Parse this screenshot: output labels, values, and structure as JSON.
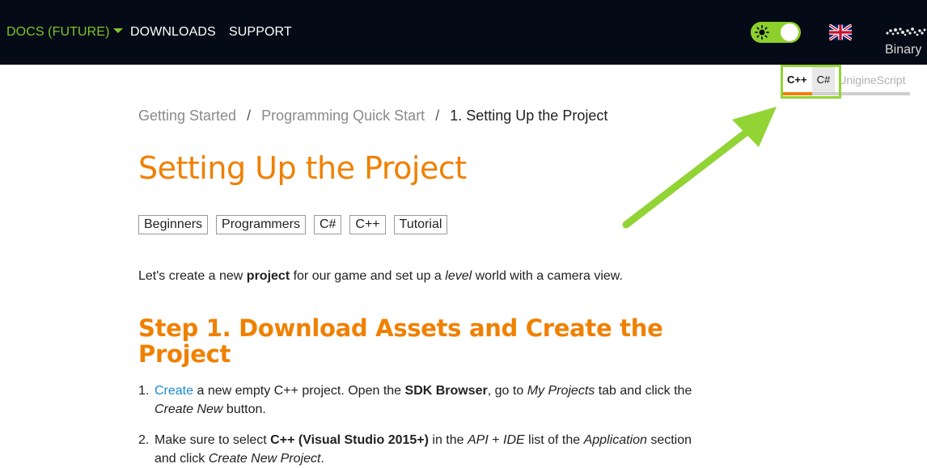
{
  "topnav": {
    "docs_label": "DOCS (FUTURE)",
    "downloads_label": "DOWNLOADS",
    "support_label": "SUPPORT",
    "binary_label": "Binary"
  },
  "lang_tabs": {
    "cpp": "C++",
    "csharp": "C#",
    "uniginescript": "UnigineScript"
  },
  "breadcrumb": {
    "item1": "Getting Started",
    "item2": "Programming Quick Start",
    "current": "1. Setting Up the Project",
    "separator": "/"
  },
  "page": {
    "title": "Setting Up the Project",
    "tags": [
      "Beginners",
      "Programmers",
      "C#",
      "C++",
      "Tutorial"
    ],
    "intro": {
      "part1": "Let's create a new ",
      "bold": "project",
      "part2": " for our game and set up a ",
      "italic": "level",
      "part3": " world with a camera view."
    },
    "step_heading": "Step 1. Download Assets and Create the Project",
    "steps": [
      {
        "num": "1.",
        "link": "Create",
        "t1": " a new empty C++ project. Open the ",
        "b1": "SDK Browser",
        "t2": ", go to ",
        "i1": "My Projects",
        "t3": " tab and click the ",
        "i2": "Create New",
        "t4": " button."
      },
      {
        "num": "2.",
        "t1": "Make sure to select ",
        "b1": "C++ (Visual Studio 2015+)",
        "t2": " in the ",
        "i1": "API",
        "t3": " + ",
        "i2": "IDE",
        "t4": " list of the ",
        "i3": "Application",
        "t5": " section and click ",
        "i4": "Create New Project",
        "t6": "."
      }
    ]
  },
  "colors": {
    "topbar_bg": "#050b16",
    "accent_orange": "#f08000",
    "accent_green": "#8dd02c",
    "link_blue": "#1a8ad1"
  }
}
